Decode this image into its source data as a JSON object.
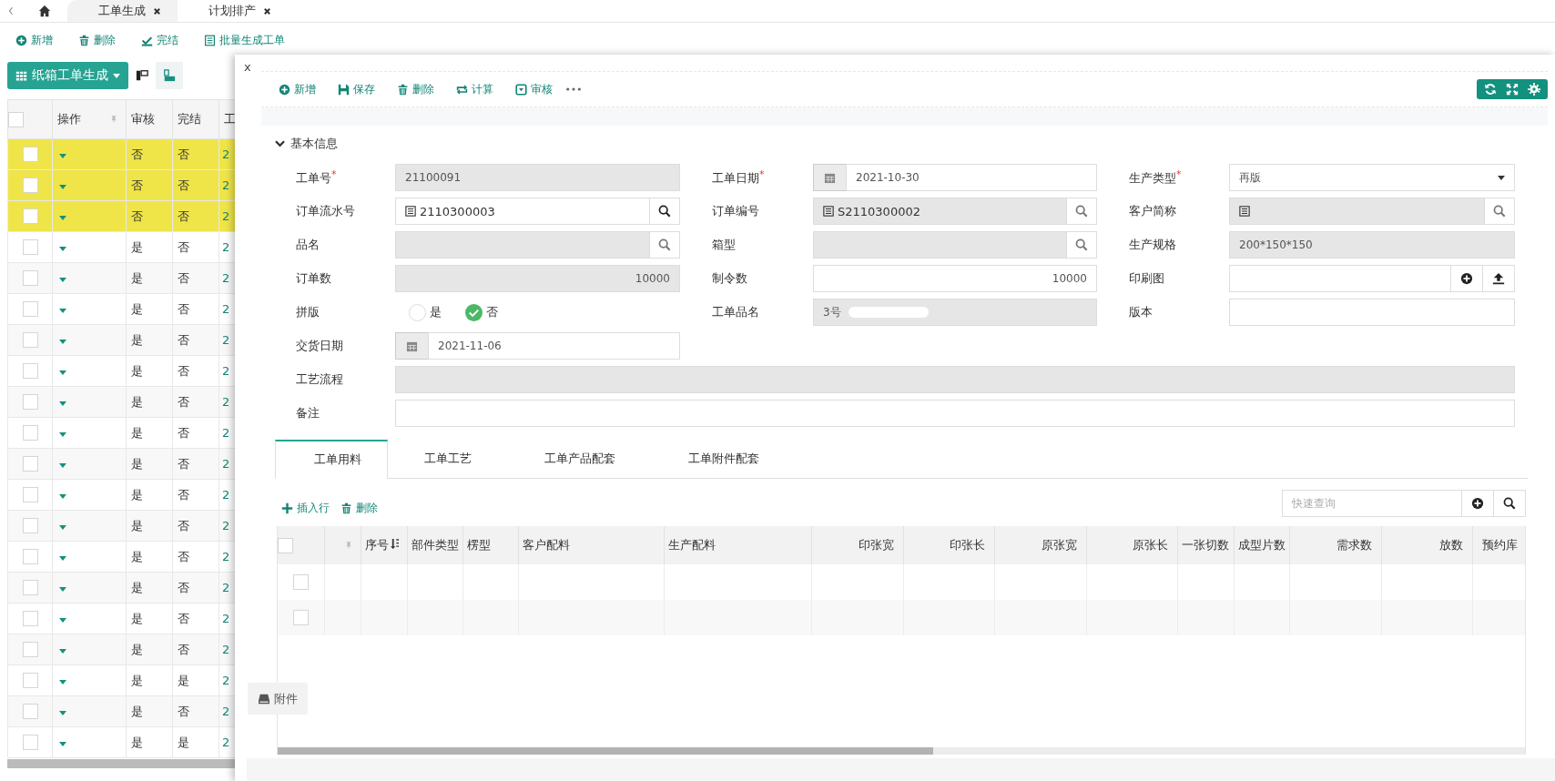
{
  "top_tabs": [
    {
      "label": "工单生成",
      "selected": true
    },
    {
      "label": "计划排产",
      "selected": false
    }
  ],
  "toolbar": [
    {
      "kind": "add",
      "label": "新增"
    },
    {
      "kind": "delete",
      "label": "删除"
    },
    {
      "kind": "finish",
      "label": "完结"
    },
    {
      "kind": "batch",
      "label": "批量生成工单"
    }
  ],
  "view_button": {
    "label": "纸箱工单生成"
  },
  "view_modes": [
    {
      "kind": "top",
      "selected": false
    },
    {
      "kind": "left",
      "selected": true
    }
  ],
  "grid": {
    "all_checked": false,
    "columns": [
      {
        "label": "操作",
        "pinned": true
      },
      {
        "label": "审核",
        "pinned": false
      },
      {
        "label": "完结",
        "pinned": false
      },
      {
        "label": "工",
        "pinned": false
      }
    ],
    "rows": [
      {
        "highlighted": true,
        "checked": false,
        "audited": "否",
        "finished": "否",
        "column_4": "2"
      },
      {
        "highlighted": true,
        "checked": false,
        "audited": "否",
        "finished": "否",
        "column_4": "2"
      },
      {
        "highlighted": true,
        "checked": false,
        "audited": "否",
        "finished": "否",
        "column_4": "2"
      },
      {
        "highlighted": false,
        "checked": false,
        "audited": "是",
        "finished": "否",
        "column_4": "2"
      },
      {
        "highlighted": false,
        "checked": false,
        "audited": "是",
        "finished": "否",
        "column_4": "2"
      },
      {
        "highlighted": false,
        "checked": false,
        "audited": "是",
        "finished": "否",
        "column_4": "2"
      },
      {
        "highlighted": false,
        "checked": false,
        "audited": "是",
        "finished": "否",
        "column_4": "2"
      },
      {
        "highlighted": false,
        "checked": false,
        "audited": "是",
        "finished": "否",
        "column_4": "2"
      },
      {
        "highlighted": false,
        "checked": false,
        "audited": "是",
        "finished": "否",
        "column_4": "2"
      },
      {
        "highlighted": false,
        "checked": false,
        "audited": "是",
        "finished": "否",
        "column_4": "2"
      },
      {
        "highlighted": false,
        "checked": false,
        "audited": "是",
        "finished": "否",
        "column_4": "2"
      },
      {
        "highlighted": false,
        "checked": false,
        "audited": "是",
        "finished": "否",
        "column_4": "2"
      },
      {
        "highlighted": false,
        "checked": false,
        "audited": "是",
        "finished": "否",
        "column_4": "2"
      },
      {
        "highlighted": false,
        "checked": false,
        "audited": "是",
        "finished": "否",
        "column_4": "2"
      },
      {
        "highlighted": false,
        "checked": false,
        "audited": "是",
        "finished": "否",
        "column_4": "2"
      },
      {
        "highlighted": false,
        "checked": false,
        "audited": "是",
        "finished": "否",
        "column_4": "2"
      },
      {
        "highlighted": false,
        "checked": false,
        "audited": "是",
        "finished": "否",
        "column_4": "2"
      },
      {
        "highlighted": false,
        "checked": false,
        "audited": "是",
        "finished": "是",
        "column_4": "2"
      },
      {
        "highlighted": false,
        "checked": false,
        "audited": "是",
        "finished": "否",
        "column_4": "2"
      },
      {
        "highlighted": false,
        "checked": false,
        "audited": "是",
        "finished": "是",
        "column_4": "2"
      }
    ]
  },
  "dialog": {
    "close": "x",
    "toolbar": [
      {
        "kind": "add",
        "label": "新增"
      },
      {
        "kind": "save",
        "label": "保存"
      },
      {
        "kind": "delete",
        "label": "删除"
      },
      {
        "kind": "calc",
        "label": "计算"
      },
      {
        "kind": "audit",
        "label": "审核"
      }
    ],
    "section": {
      "title": "基本信息",
      "expanded": true
    },
    "fields": [
      {
        "kind": "text",
        "label": "工单号$^{*}$",
        "value": "21100091",
        "readonly": true
      },
      {
        "kind": "date",
        "label": "工单日期$^{*}$",
        "value": "2021-10-30",
        "readonly": false
      },
      {
        "kind": "select",
        "label": "生产类型$^{*}$",
        "value": "再版",
        "readonly": false
      },
      {
        "kind": "lookup",
        "label": "订单流水号",
        "value": "2110300003",
        "list_icon": true,
        "readonly": false
      },
      {
        "kind": "lookup",
        "label": "订单编号",
        "value": "S2110300002",
        "list_icon": true,
        "readonly": true
      },
      {
        "kind": "lookup",
        "label": "客户简称",
        "list_icon": true,
        "readonly": true
      },
      {
        "kind": "lookup",
        "label": "品名",
        "list_icon": false,
        "readonly": true
      },
      {
        "kind": "lookup",
        "label": "箱型",
        "list_icon": false,
        "readonly": true
      },
      {
        "kind": "text",
        "label": "生产规格",
        "value": "200*150*150",
        "readonly": true
      },
      {
        "kind": "number",
        "label": "订单数",
        "value": "10000",
        "readonly": true
      },
      {
        "kind": "number",
        "label": "制令数",
        "value": "10000",
        "readonly": false
      },
      {
        "kind": "upload",
        "label": "印刷图",
        "readonly": false
      },
      {
        "kind": "radio",
        "label": "拼版",
        "options": [
          {
            "label": "是",
            "selected": false
          },
          {
            "label": "否",
            "selected": true
          }
        ]
      },
      {
        "kind": "text",
        "label": "工单品名",
        "value": "3号",
        "redacted": true,
        "readonly": true
      },
      {
        "kind": "text",
        "label": "版本",
        "readonly": false
      },
      {
        "kind": "date",
        "label": "交货日期",
        "value": "2021-11-06",
        "readonly": false
      },
      {
        "kind": "wide",
        "label": "工艺流程",
        "readonly": true
      },
      {
        "kind": "wide",
        "label": "备注",
        "readonly": false
      }
    ],
    "sub_tabs": [
      {
        "label": "工单用料",
        "selected": true
      },
      {
        "label": "工单工艺",
        "selected": false
      },
      {
        "label": "工单产品配套",
        "selected": false
      },
      {
        "label": "工单附件配套",
        "selected": false
      }
    ],
    "sub_toolbar": [
      {
        "kind": "insert",
        "label": "插入行"
      },
      {
        "kind": "delete",
        "label": "删除"
      }
    ],
    "quick_search": {
      "placeholder": "快速查询"
    },
    "detail_grid": {
      "all_checked": false,
      "columns": [
        {
          "label": "序号",
          "kind": "text",
          "sorted": true
        },
        {
          "label": "部件类型",
          "kind": "text",
          "sorted": false
        },
        {
          "label": "楞型",
          "kind": "text",
          "sorted": false
        },
        {
          "label": "客户配料",
          "kind": "text",
          "sorted": false
        },
        {
          "label": "生产配料",
          "kind": "text",
          "sorted": false
        },
        {
          "label": "印张宽",
          "kind": "number",
          "sorted": false
        },
        {
          "label": "印张长",
          "kind": "number",
          "sorted": false
        },
        {
          "label": "原张宽",
          "kind": "number",
          "sorted": false
        },
        {
          "label": "原张长",
          "kind": "number",
          "sorted": false
        },
        {
          "label": "一张切数",
          "kind": "text",
          "sorted": false
        },
        {
          "label": "成型片数",
          "kind": "text",
          "sorted": false
        },
        {
          "label": "需求数",
          "kind": "number",
          "sorted": false
        },
        {
          "label": "放数",
          "kind": "number",
          "sorted": false
        },
        {
          "label": "预约库",
          "kind": "number",
          "sorted": false
        }
      ],
      "rows": [
        {
          "checked": false
        },
        {
          "checked": false
        }
      ]
    },
    "attach_button": {
      "label": "附件"
    }
  }
}
